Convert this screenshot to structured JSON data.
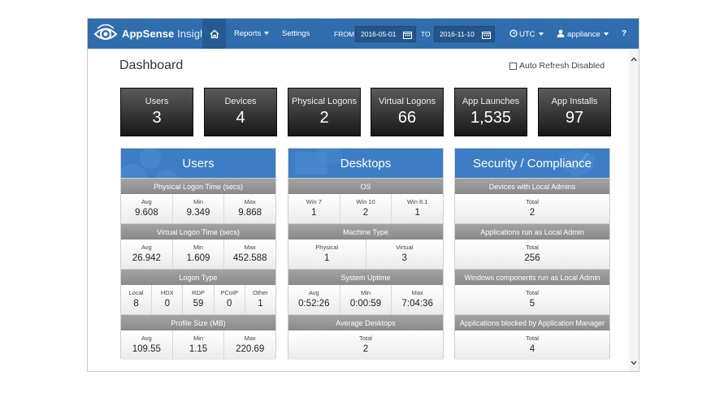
{
  "nav": {
    "brand_strong": "AppSense",
    "brand_light": " Insight",
    "reports": "Reports",
    "settings": "Settings",
    "from_label": "FROM",
    "from_date": "2016-05-01",
    "to_label": "TO",
    "to_date": "2016-11-10",
    "timezone": "UTC",
    "user": "appliance",
    "help": "?"
  },
  "page": {
    "title": "Dashboard",
    "auto_refresh": "Auto Refresh Disabled"
  },
  "stats": [
    {
      "label": "Users",
      "value": "3"
    },
    {
      "label": "Devices",
      "value": "4"
    },
    {
      "label": "Physical Logons",
      "value": "2"
    },
    {
      "label": "Virtual Logons",
      "value": "66"
    },
    {
      "label": "App Launches",
      "value": "1,535"
    },
    {
      "label": "App Installs",
      "value": "97"
    }
  ],
  "panels": {
    "users": {
      "title": "Users",
      "sections": [
        {
          "title": "Physical Logon Time (secs)",
          "cells": [
            {
              "label": "Avg",
              "value": "9.608"
            },
            {
              "label": "Min",
              "value": "9.349"
            },
            {
              "label": "Max",
              "value": "9.868"
            }
          ]
        },
        {
          "title": "Virtual Logon Time (secs)",
          "cells": [
            {
              "label": "Avg",
              "value": "26.942"
            },
            {
              "label": "Min",
              "value": "1.609"
            },
            {
              "label": "Max",
              "value": "452.588"
            }
          ]
        },
        {
          "title": "Logon Type",
          "cells": [
            {
              "label": "Local",
              "value": "8"
            },
            {
              "label": "HDX",
              "value": "0"
            },
            {
              "label": "RDP",
              "value": "59"
            },
            {
              "label": "PCoIP",
              "value": "0"
            },
            {
              "label": "Other",
              "value": "1"
            }
          ]
        },
        {
          "title": "Profile Size (MB)",
          "cells": [
            {
              "label": "Avg",
              "value": "109.55"
            },
            {
              "label": "Min",
              "value": "1.15"
            },
            {
              "label": "Max",
              "value": "220.69"
            }
          ]
        }
      ]
    },
    "desktops": {
      "title": "Desktops",
      "sections": [
        {
          "title": "OS",
          "cells": [
            {
              "label": "Win 7",
              "value": "1"
            },
            {
              "label": "Win 10",
              "value": "2"
            },
            {
              "label": "Win 8.1",
              "value": "1"
            }
          ]
        },
        {
          "title": "Machine Type",
          "cells": [
            {
              "label": "Physical",
              "value": "1"
            },
            {
              "label": "Virtual",
              "value": "3"
            }
          ]
        },
        {
          "title": "System Uptime",
          "cells": [
            {
              "label": "Avg",
              "value": "0:52:26"
            },
            {
              "label": "Min",
              "value": "0:00:59"
            },
            {
              "label": "Max",
              "value": "7:04:36"
            }
          ]
        },
        {
          "title": "Average Desktops",
          "cells": [
            {
              "label": "Total",
              "value": "2"
            }
          ]
        }
      ]
    },
    "security": {
      "title": "Security / Compliance",
      "sections": [
        {
          "title": "Devices with Local Admins",
          "cells": [
            {
              "label": "Total",
              "value": "2"
            }
          ]
        },
        {
          "title": "Applications run as Local Admin",
          "cells": [
            {
              "label": "Total",
              "value": "256"
            }
          ]
        },
        {
          "title": "Windows components run as Local Admin",
          "cells": [
            {
              "label": "Total",
              "value": "5"
            }
          ]
        },
        {
          "title": "Applications blocked by Application Manager",
          "cells": [
            {
              "label": "Total",
              "value": "4"
            }
          ]
        }
      ]
    }
  }
}
